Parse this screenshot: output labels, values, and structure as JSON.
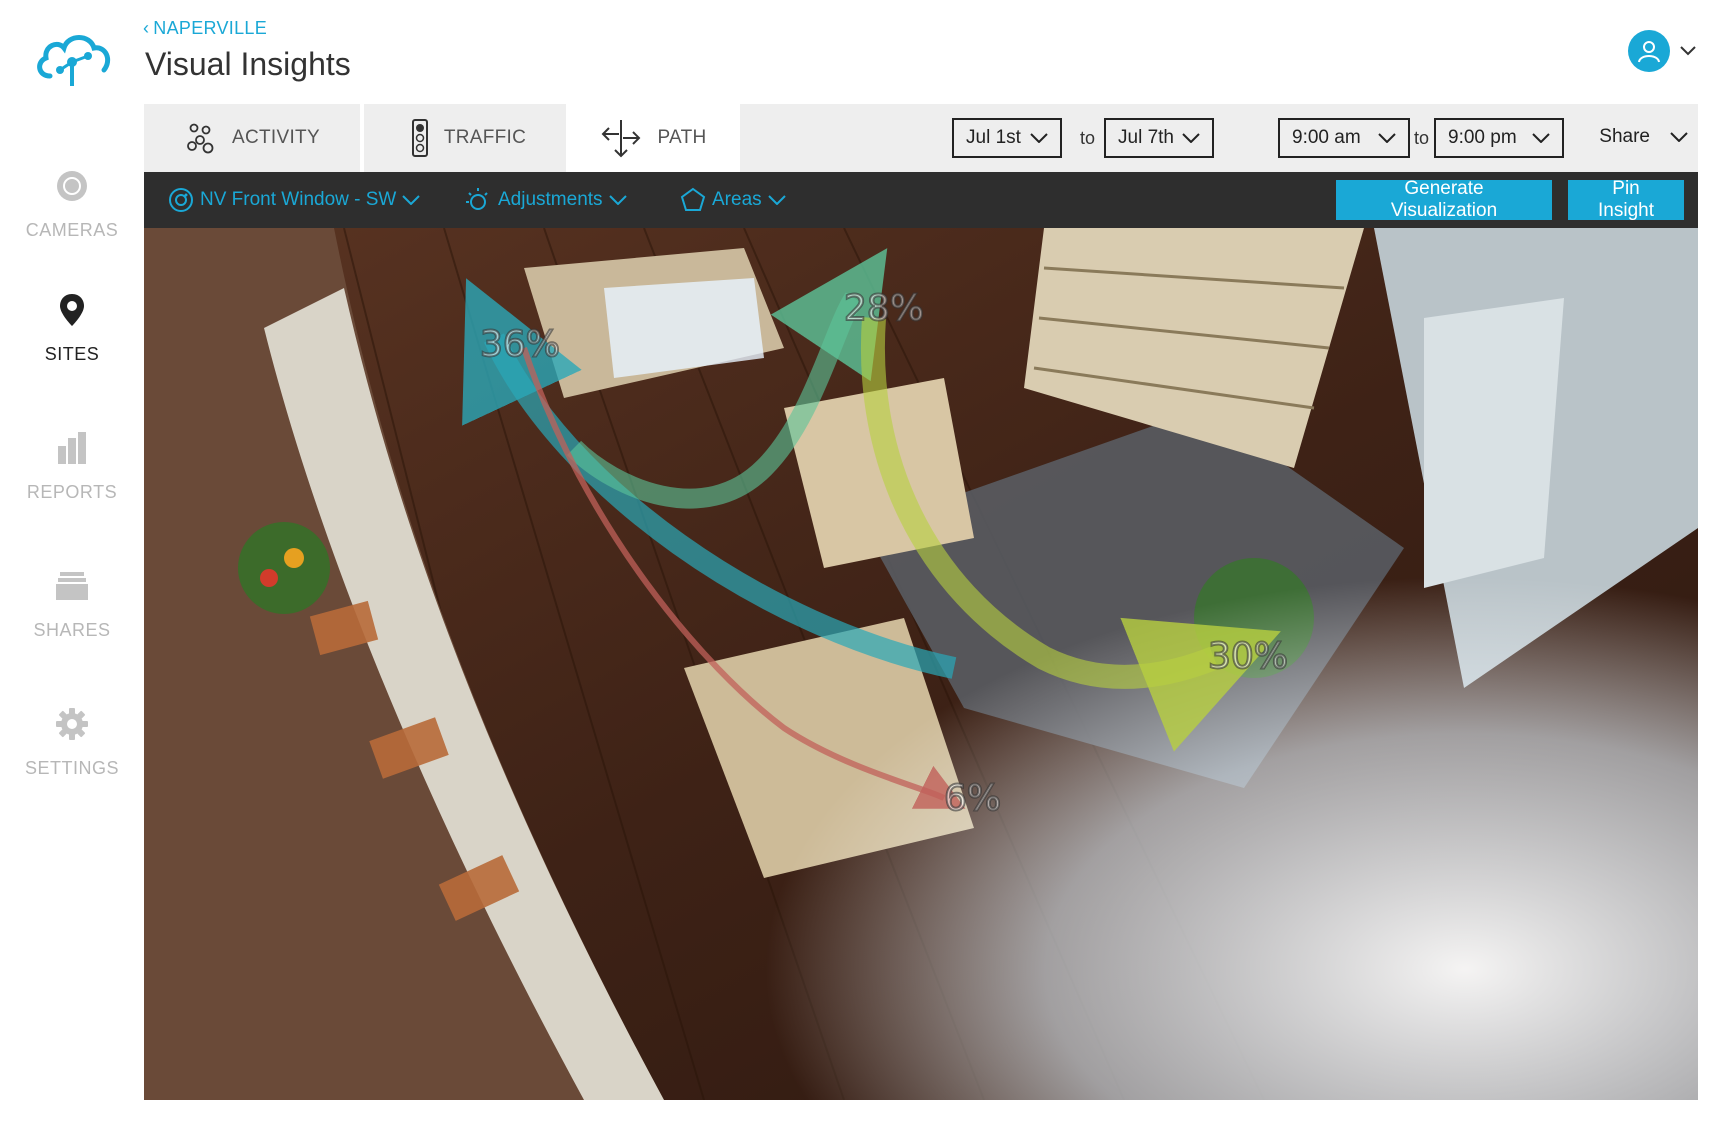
{
  "app": {
    "breadcrumb": "NAPERVILLE",
    "title": "Visual Insights"
  },
  "sidebar": {
    "items": [
      {
        "label": "CAMERAS",
        "icon": "camera-icon",
        "active": false
      },
      {
        "label": "SITES",
        "icon": "map-pin-icon",
        "active": true
      },
      {
        "label": "REPORTS",
        "icon": "bar-chart-icon",
        "active": false
      },
      {
        "label": "SHARES",
        "icon": "stack-icon",
        "active": false
      },
      {
        "label": "SETTINGS",
        "icon": "gear-icon",
        "active": false
      }
    ]
  },
  "tabs": [
    {
      "label": "ACTIVITY",
      "icon": "activity-icon",
      "active": false
    },
    {
      "label": "TRAFFIC",
      "icon": "traffic-light-icon",
      "active": false
    },
    {
      "label": "PATH",
      "icon": "path-arrows-icon",
      "active": true
    }
  ],
  "filters": {
    "date_from": "Jul 1st",
    "date_to": "Jul 7th",
    "time_from": "9:00 am",
    "time_to": "9:00 pm",
    "to_label": "to",
    "share_label": "Share"
  },
  "controls": {
    "camera": "NV Front Window - SW",
    "adjustments": "Adjustments",
    "areas": "Areas",
    "generate_label": "Generate Visualization",
    "pin_label": "Pin Insight"
  },
  "paths": [
    {
      "label": "36%",
      "color": "#2aa8b8"
    },
    {
      "label": "28%",
      "color": "#5cc49a"
    },
    {
      "label": "30%",
      "color": "#b8d040"
    },
    {
      "label": "6%",
      "color": "#c0605a"
    }
  ],
  "colors": {
    "accent": "#1aa8d6",
    "control_bar": "#2e2e2e",
    "toolbar": "#eeeeee"
  }
}
